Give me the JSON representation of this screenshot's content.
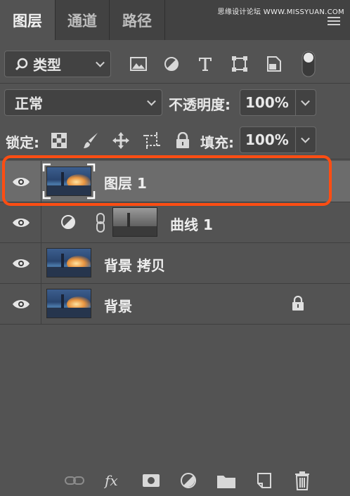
{
  "tabs": [
    {
      "label": "图层",
      "active": true
    },
    {
      "label": "通道",
      "active": false
    },
    {
      "label": "路径",
      "active": false
    }
  ],
  "watermark": "思缘设计论坛 WWW.MISSYUAN.COM",
  "filter": {
    "search_label": "类型",
    "icons": [
      "image-filter-icon",
      "adjustment-filter-icon",
      "type-filter-icon",
      "shape-filter-icon",
      "smart-object-filter-icon",
      "filter-toggle-icon"
    ]
  },
  "blend": {
    "mode": "正常",
    "opacity_label": "不透明度:",
    "opacity_value": "100%"
  },
  "lock": {
    "label": "锁定:",
    "fill_label": "填充:",
    "fill_value": "100%",
    "icons": [
      "lock-transparent-pixels-icon",
      "lock-image-pixels-icon",
      "lock-position-icon",
      "lock-artboard-icon",
      "lock-all-icon"
    ]
  },
  "layers": [
    {
      "name": "图层 1",
      "selected": true,
      "visible": true
    },
    {
      "name": "曲线 1",
      "selected": false,
      "visible": true,
      "type": "adjustment"
    },
    {
      "name": "背景 拷贝",
      "selected": false,
      "visible": true
    },
    {
      "name": "背景",
      "selected": false,
      "visible": true,
      "locked": true
    }
  ],
  "bottom_icons": [
    "link-layers-icon",
    "fx-icon",
    "add-mask-icon",
    "new-adjustment-icon",
    "new-group-icon",
    "new-layer-icon",
    "delete-layer-icon"
  ],
  "colors": {
    "highlight": "#ff4d12",
    "panel": "#535353",
    "selected_row": "#6c6c6c"
  }
}
